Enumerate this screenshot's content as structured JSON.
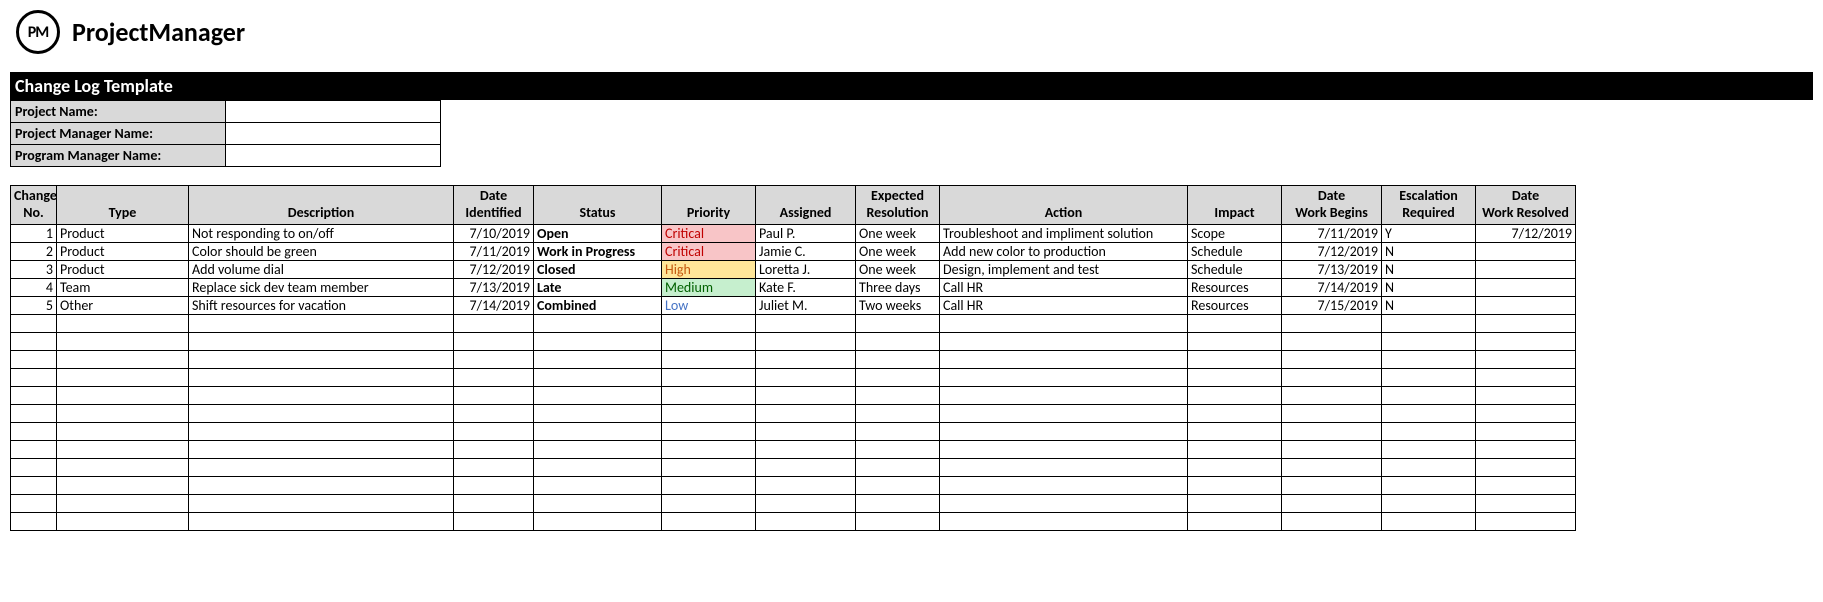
{
  "brand": {
    "logo_initials": "PM",
    "logo_text": "ProjectManager"
  },
  "title": "Change Log Template",
  "meta": {
    "project_name_label": "Project Name:",
    "project_name_value": "",
    "project_manager_label": "Project Manager Name:",
    "project_manager_value": "",
    "program_manager_label": "Program Manager Name:",
    "program_manager_value": ""
  },
  "columns": {
    "change_no": "Change No.",
    "type": "Type",
    "description": "Description",
    "date_identified": "Date Identified",
    "status": "Status",
    "priority": "Priority",
    "assigned": "Assigned",
    "expected_resolution": "Expected Resolution",
    "action": "Action",
    "impact": "Impact",
    "date_work_begins": "Date Work Begins",
    "escalation_required": "Escalation Required",
    "date_work_resolved": "Date Work Resolved"
  },
  "rows": [
    {
      "no": "1",
      "type": "Product",
      "description": "Not responding to on/off",
      "date_identified": "7/10/2019",
      "status": "Open",
      "priority": "Critical",
      "priority_class": "p-critical",
      "assigned": "Paul P.",
      "expected_resolution": "One week",
      "action": "Troubleshoot and impliment solution",
      "impact": "Scope",
      "date_work_begins": "7/11/2019",
      "escalation": "Y",
      "date_work_resolved": "7/12/2019"
    },
    {
      "no": "2",
      "type": "Product",
      "description": "Color should be green",
      "date_identified": "7/11/2019",
      "status": "Work in Progress",
      "priority": "Critical",
      "priority_class": "p-critical",
      "assigned": "Jamie C.",
      "expected_resolution": "One week",
      "action": "Add new color to production",
      "impact": "Schedule",
      "date_work_begins": "7/12/2019",
      "escalation": "N",
      "date_work_resolved": ""
    },
    {
      "no": "3",
      "type": "Product",
      "description": "Add volume dial",
      "date_identified": "7/12/2019",
      "status": "Closed",
      "priority": "High",
      "priority_class": "p-high",
      "assigned": "Loretta J.",
      "expected_resolution": "One week",
      "action": "Design, implement and test",
      "impact": "Schedule",
      "date_work_begins": "7/13/2019",
      "escalation": "N",
      "date_work_resolved": ""
    },
    {
      "no": "4",
      "type": "Team",
      "description": "Replace sick dev team member",
      "date_identified": "7/13/2019",
      "status": "Late",
      "priority": "Medium",
      "priority_class": "p-medium",
      "assigned": "Kate F.",
      "expected_resolution": "Three days",
      "action": "Call HR",
      "impact": "Resources",
      "date_work_begins": "7/14/2019",
      "escalation": "N",
      "date_work_resolved": ""
    },
    {
      "no": "5",
      "type": "Other",
      "description": "Shift resources for vacation",
      "date_identified": "7/14/2019",
      "status": "Combined",
      "priority": "Low",
      "priority_class": "p-low",
      "assigned": "Juliet M.",
      "expected_resolution": "Two weeks",
      "action": "Call HR",
      "impact": "Resources",
      "date_work_begins": "7/15/2019",
      "escalation": "N",
      "date_work_resolved": ""
    }
  ],
  "empty_row_count": 12
}
